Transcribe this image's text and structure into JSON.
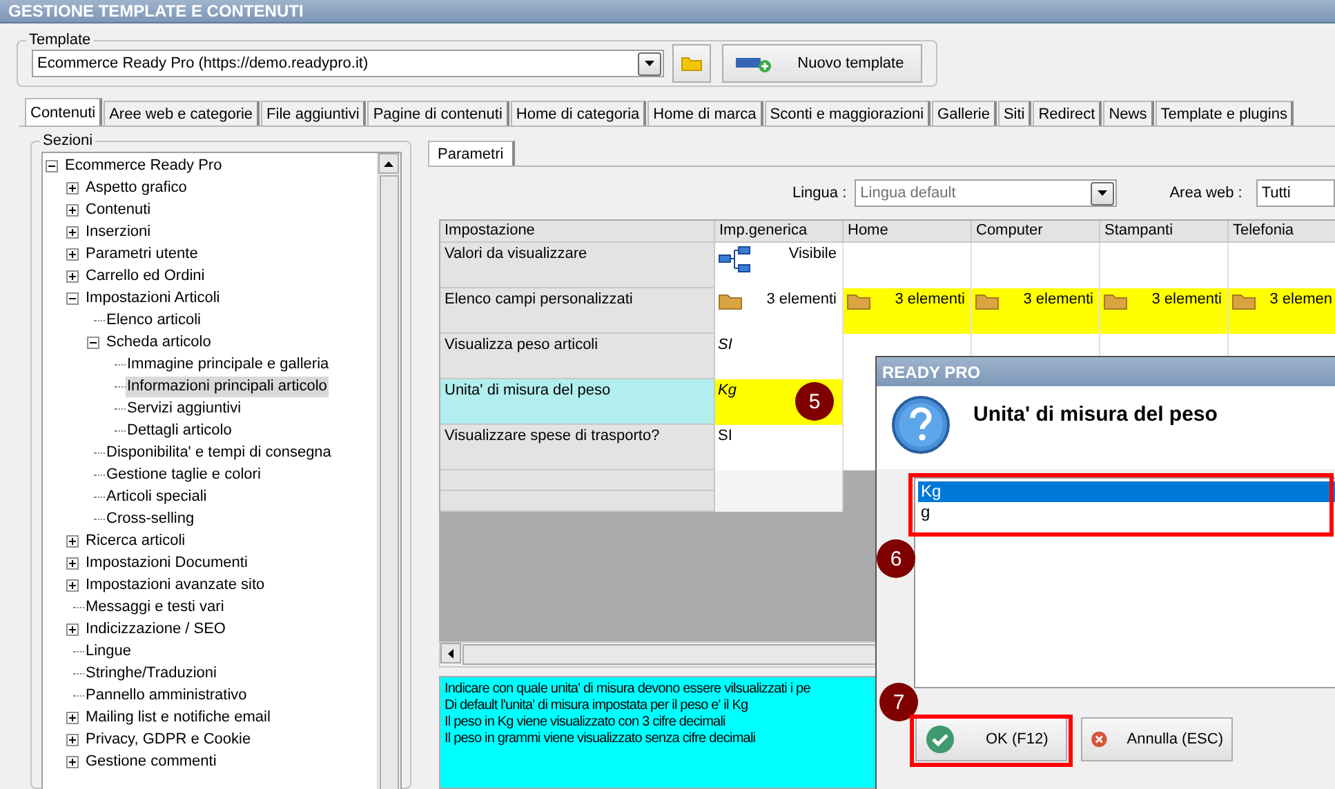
{
  "window": {
    "title": "GESTIONE TEMPLATE E CONTENUTI"
  },
  "template": {
    "label": "Template",
    "value": "Ecommerce Ready Pro (https://demo.readypro.it)",
    "new_button": "Nuovo template"
  },
  "tabs": [
    {
      "label": "Contenuti",
      "selected": true
    },
    {
      "label": "Aree web e categorie",
      "selected": false
    },
    {
      "label": "File aggiuntivi",
      "selected": false
    },
    {
      "label": "Pagine di contenuti",
      "selected": false
    },
    {
      "label": "Home di categoria",
      "selected": false
    },
    {
      "label": "Home di marca",
      "selected": false
    },
    {
      "label": "Sconti e maggiorazioni",
      "selected": false
    },
    {
      "label": "Gallerie",
      "selected": false
    },
    {
      "label": "Siti",
      "selected": false
    },
    {
      "label": "Redirect",
      "selected": false
    },
    {
      "label": "News",
      "selected": false
    },
    {
      "label": "Template e plugins",
      "selected": false
    }
  ],
  "sections": {
    "label": "Sezioni",
    "tree": [
      {
        "label": "Ecommerce Ready Pro",
        "kind": "node",
        "expanded": true,
        "selected": false,
        "children": [
          {
            "label": "Aspetto grafico",
            "kind": "node",
            "expanded": false,
            "selected": false
          },
          {
            "label": "Contenuti",
            "kind": "node",
            "expanded": false,
            "selected": false
          },
          {
            "label": "Inserzioni",
            "kind": "node",
            "expanded": false,
            "selected": false
          },
          {
            "label": "Parametri utente",
            "kind": "node",
            "expanded": false,
            "selected": false
          },
          {
            "label": "Carrello ed Ordini",
            "kind": "node",
            "expanded": false,
            "selected": false
          },
          {
            "label": "Impostazioni Articoli",
            "kind": "node",
            "expanded": true,
            "selected": false,
            "children": [
              {
                "label": "Elenco articoli",
                "kind": "leaf",
                "selected": false
              },
              {
                "label": "Scheda articolo",
                "kind": "node",
                "expanded": true,
                "selected": false,
                "children": [
                  {
                    "label": "Immagine principale e galleria",
                    "kind": "leaf",
                    "selected": false
                  },
                  {
                    "label": "Informazioni principali articolo",
                    "kind": "leaf",
                    "selected": true
                  },
                  {
                    "label": "Servizi aggiuntivi",
                    "kind": "leaf",
                    "selected": false
                  },
                  {
                    "label": "Dettagli articolo",
                    "kind": "leaf",
                    "selected": false
                  }
                ]
              },
              {
                "label": "Disponibilita' e tempi di consegna",
                "kind": "leaf",
                "selected": false
              },
              {
                "label": "Gestione taglie e colori",
                "kind": "leaf",
                "selected": false
              },
              {
                "label": "Articoli speciali",
                "kind": "leaf",
                "selected": false
              },
              {
                "label": "Cross-selling",
                "kind": "leaf",
                "selected": false
              }
            ]
          },
          {
            "label": "Ricerca articoli",
            "kind": "node",
            "expanded": false,
            "selected": false
          },
          {
            "label": "Impostazioni Documenti",
            "kind": "node",
            "expanded": false,
            "selected": false
          },
          {
            "label": "Impostazioni avanzate sito",
            "kind": "node",
            "expanded": false,
            "selected": false
          },
          {
            "label": "Messaggi e testi vari",
            "kind": "leaf",
            "selected": false
          },
          {
            "label": "Indicizzazione / SEO",
            "kind": "node",
            "expanded": false,
            "selected": false
          },
          {
            "label": "Lingue",
            "kind": "leaf",
            "selected": false
          },
          {
            "label": "Stringhe/Traduzioni",
            "kind": "leaf",
            "selected": false
          },
          {
            "label": "Pannello amministrativo",
            "kind": "leaf",
            "selected": false
          },
          {
            "label": "Mailing list e notifiche email",
            "kind": "node",
            "expanded": false,
            "selected": false
          },
          {
            "label": "Privacy, GDPR e Cookie",
            "kind": "node",
            "expanded": false,
            "selected": false
          },
          {
            "label": "Gestione commenti",
            "kind": "node",
            "expanded": false,
            "selected": false
          }
        ]
      }
    ]
  },
  "panel_tabs": [
    {
      "label": "Parametri",
      "selected": true
    }
  ],
  "filters": {
    "language_label": "Lingua :",
    "language_value": "Lingua default",
    "area_label": "Area web :",
    "area_value": "Tutti"
  },
  "grid": {
    "columns": [
      "Impostazione",
      "Imp.generica",
      "Home",
      "Computer",
      "Stampanti",
      "Telefonia"
    ],
    "rows": [
      {
        "selected": false,
        "cells": [
          {
            "text": "Valori da visualizzare",
            "kind": "label"
          },
          {
            "text": "Visibile",
            "kind": "tree",
            "highlight": false,
            "italic": false
          }
        ]
      },
      {
        "selected": false,
        "cells": [
          {
            "text": "Elenco campi personalizzati",
            "kind": "label"
          },
          {
            "text": "3 elementi",
            "kind": "folder",
            "highlight": false,
            "italic": false
          },
          {
            "text": "3 elementi",
            "kind": "folder",
            "highlight": true,
            "italic": false
          },
          {
            "text": "3 elementi",
            "kind": "folder",
            "highlight": true,
            "italic": false
          },
          {
            "text": "3 elementi",
            "kind": "folder",
            "highlight": true,
            "italic": false
          },
          {
            "text": "3 elemen",
            "kind": "folder",
            "highlight": true,
            "italic": false
          }
        ]
      },
      {
        "selected": false,
        "cells": [
          {
            "text": "Visualizza peso articoli",
            "kind": "label"
          },
          {
            "text": "SI",
            "kind": "plain",
            "highlight": false,
            "italic": true
          }
        ]
      },
      {
        "selected": true,
        "cells": [
          {
            "text": "Unita' di misura del peso",
            "kind": "label"
          },
          {
            "text": "Kg",
            "kind": "plain",
            "highlight": true,
            "italic": true,
            "marker": "5"
          }
        ]
      },
      {
        "selected": false,
        "cells": [
          {
            "text": "Visualizzare spese di trasporto?",
            "kind": "label"
          },
          {
            "text": "SI",
            "kind": "plain",
            "highlight": false,
            "italic": false
          }
        ]
      }
    ]
  },
  "info_lines": [
    "Indicare con quale unita' di misura devono essere vilsualizzati i pe",
    "Di default l'unita' di misura impostata per il peso e' il Kg",
    "Il peso in Kg viene visualizzato con 3 cifre decimali",
    "Il peso in grammi viene visualizzato senza cifre decimali"
  ],
  "dialog": {
    "title": "READY PRO",
    "heading": "Unita' di misura del peso",
    "options": [
      {
        "label": "Kg",
        "selected": true
      },
      {
        "label": "g",
        "selected": false
      }
    ],
    "list_marker": "6",
    "button_marker": "7",
    "ok_button": "OK (F12)",
    "cancel_button": "Annulla (ESC)"
  }
}
